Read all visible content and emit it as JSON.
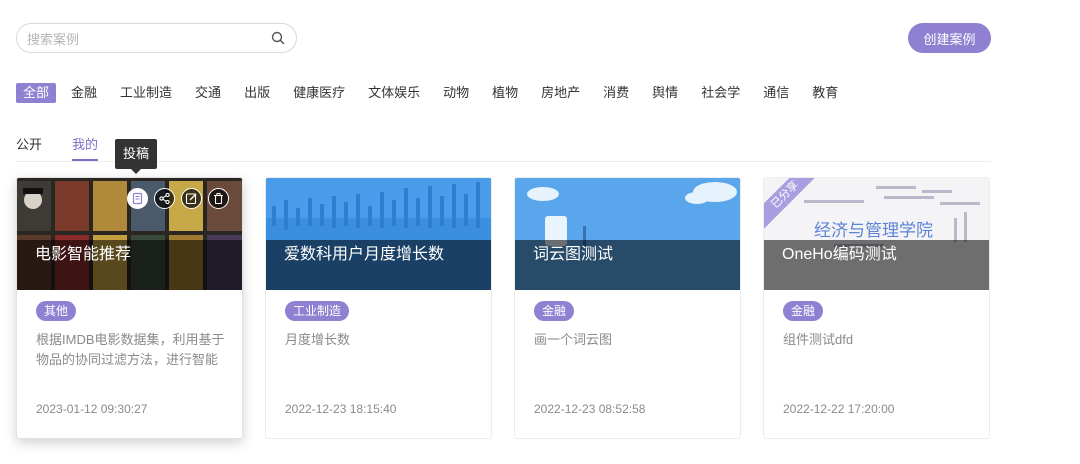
{
  "search": {
    "placeholder": "搜索案例",
    "icon": "search-icon"
  },
  "create_button": "创建案例",
  "categories": [
    "全部",
    "金融",
    "工业制造",
    "交通",
    "出版",
    "健康医疗",
    "文体娱乐",
    "动物",
    "植物",
    "房地产",
    "消费",
    "舆情",
    "社会学",
    "通信",
    "教育"
  ],
  "active_category": "全部",
  "tabs": [
    "公开",
    "我的"
  ],
  "active_tab": "我的",
  "tooltip": "投稿",
  "accent_color": "#8f80d1",
  "cards": [
    {
      "title": "电影智能推荐",
      "tag": "其他",
      "desc": "根据IMDB电影数据集，利用基于物品的协同过滤方法，进行智能",
      "time": "2023-01-12 09:30:27",
      "actions": [
        "submit-icon",
        "share-icon",
        "edit-icon",
        "delete-icon"
      ]
    },
    {
      "title": "爱数科用户月度增长数",
      "tag": "工业制造",
      "desc": "月度增长数",
      "time": "2022-12-23 18:15:40"
    },
    {
      "title": "词云图测试",
      "tag": "金融",
      "desc": "画一个词云图",
      "time": "2022-12-23 08:52:58"
    },
    {
      "title": "OneHo编码测试",
      "tag": "金融",
      "desc": "组件测试dfd",
      "time": "2022-12-22 17:20:00",
      "ribbon": "已分享",
      "wordcloud_text": "经济与管理学院"
    }
  ]
}
